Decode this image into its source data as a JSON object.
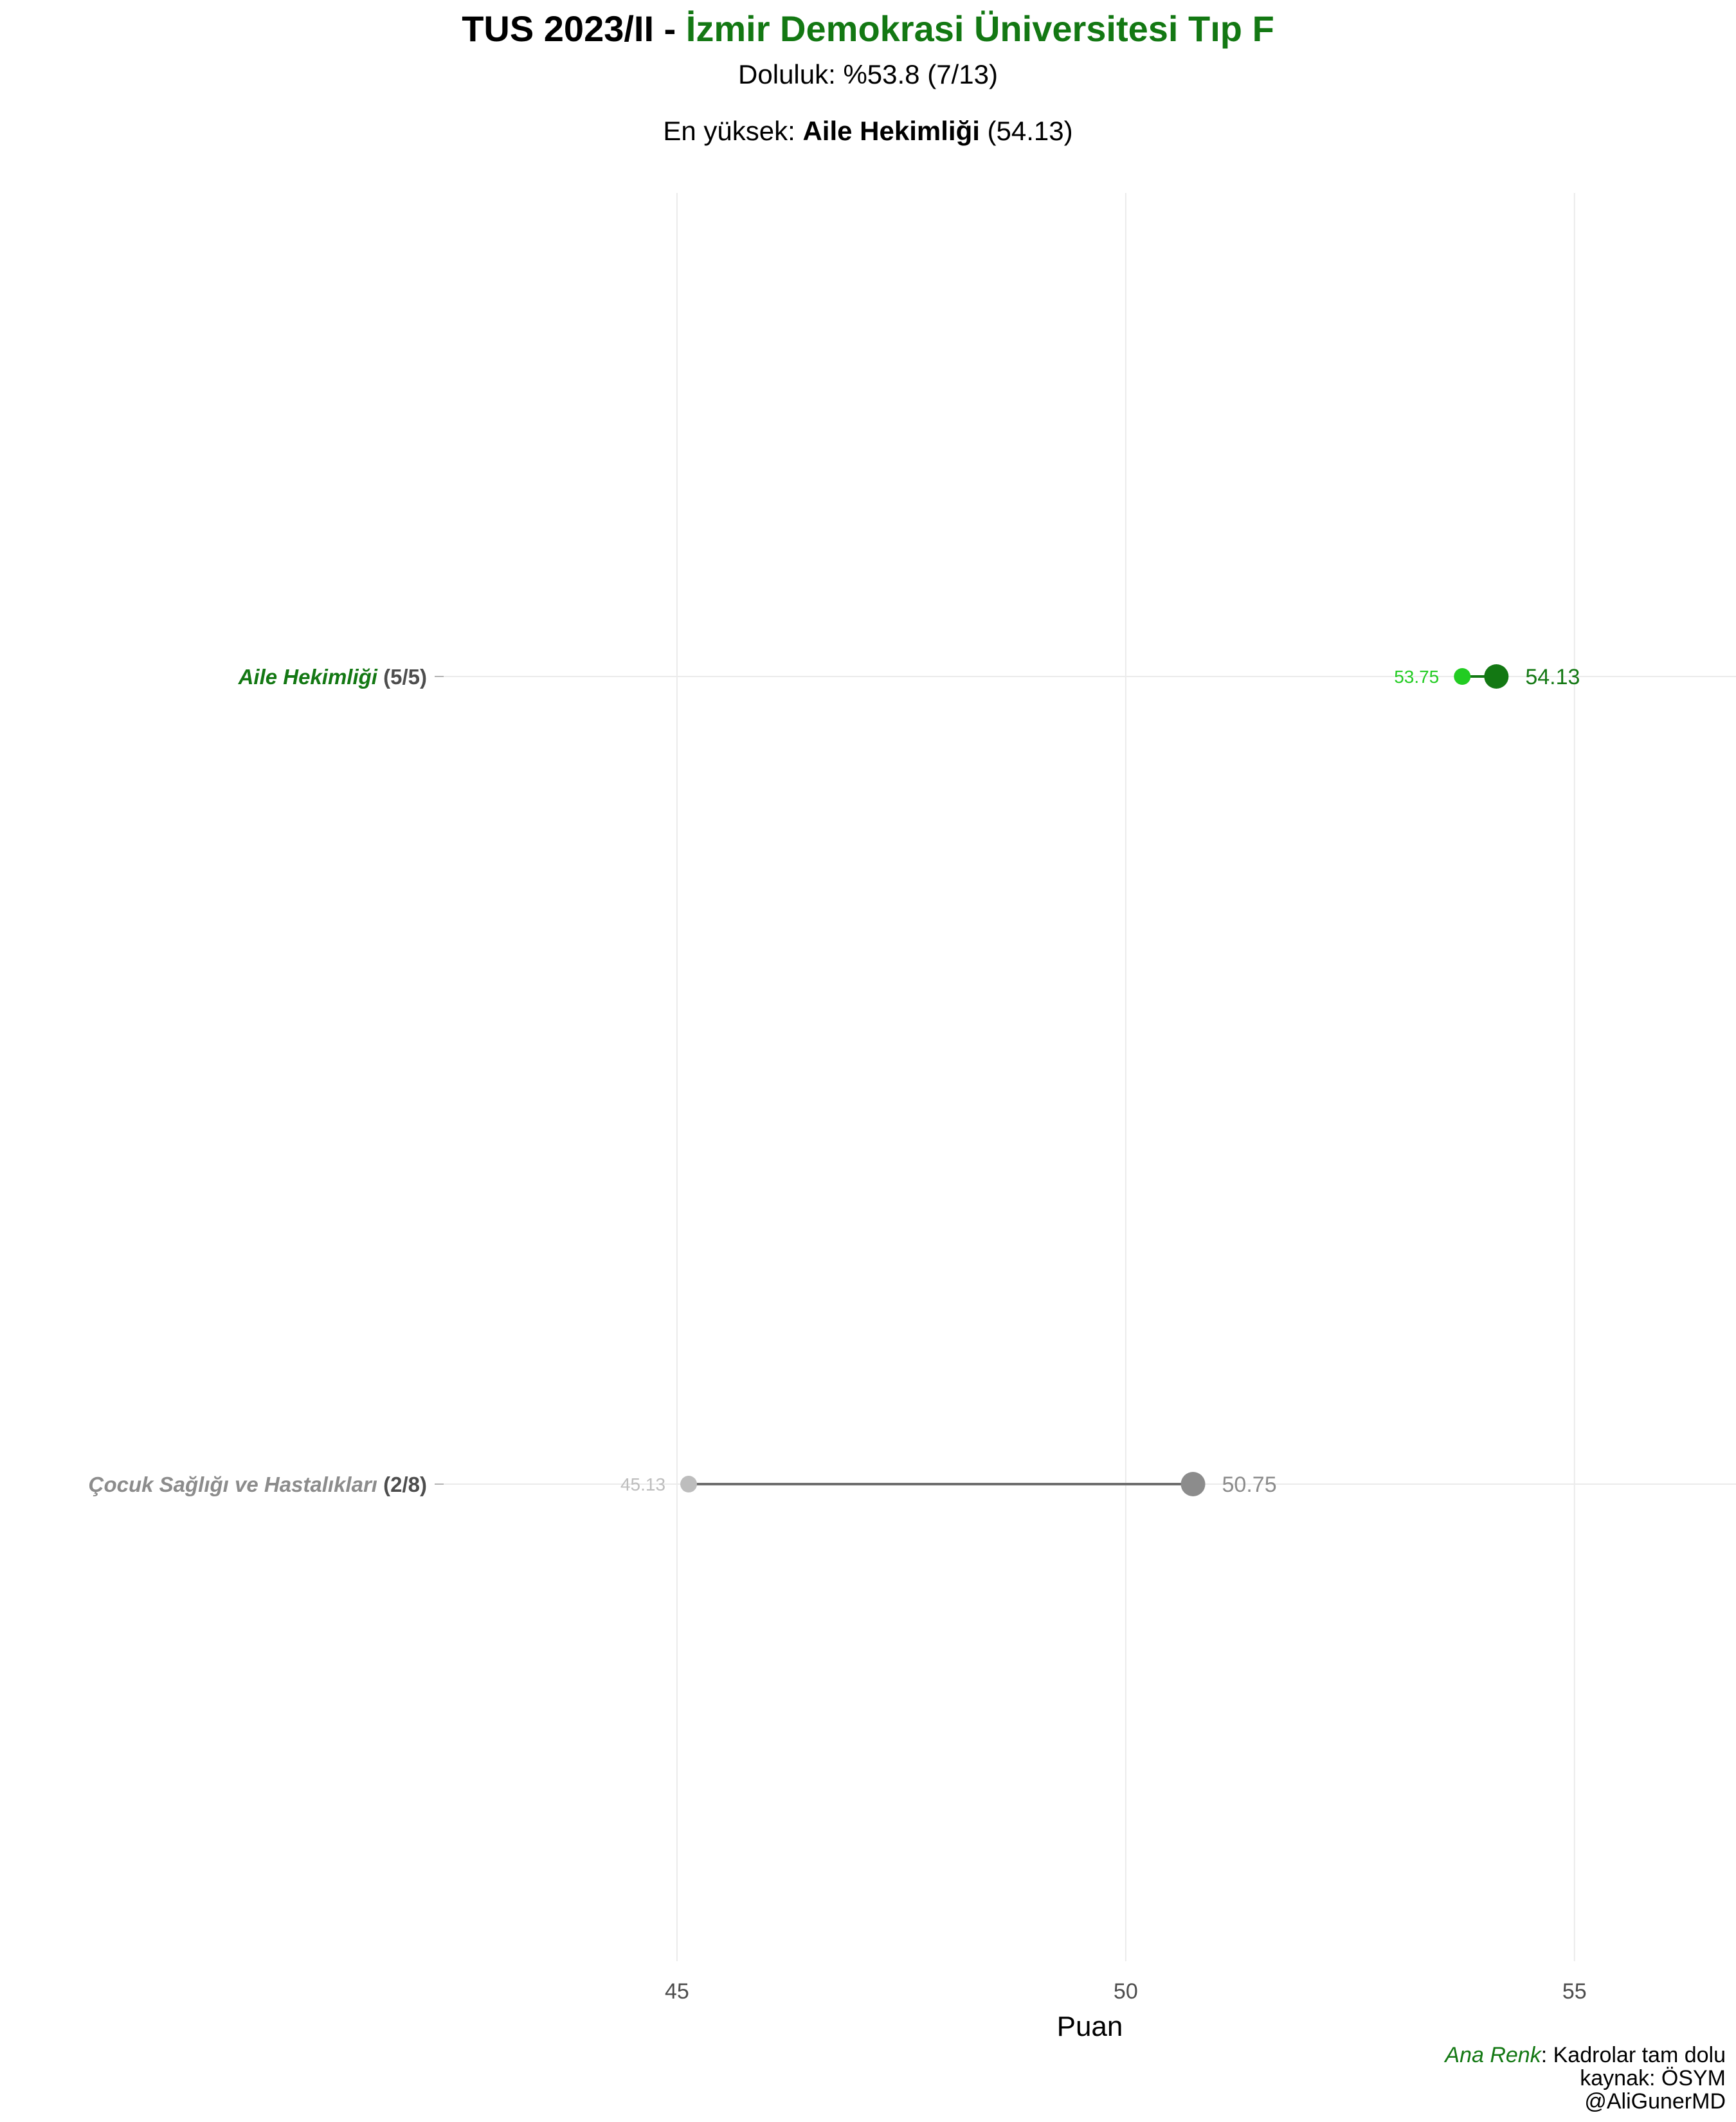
{
  "header": {
    "title_prefix": "TUS 2023/II - ",
    "title_highlight": "İzmir Demokrasi Üniversitesi Tıp F",
    "doluluk": "Doluluk: %53.8 (7/13)",
    "highest_prefix": "En yüksek: ",
    "highest_name": "Aile Hekimliği",
    "highest_value": " (54.13)"
  },
  "colors": {
    "accent": "#137813",
    "accent_light": "#22cc22",
    "gray_dark": "#8c8c8c",
    "gray_light": "#bdbdbd",
    "grid": "#ebebeb"
  },
  "chart_data": {
    "type": "dumbbell",
    "xlabel": "Puan",
    "xlim": [
      42.4,
      56.8
    ],
    "xticks": [
      45,
      50,
      55
    ],
    "grid": true,
    "rows": [
      {
        "name": "Aile Hekimliği",
        "count": "(5/5)",
        "min": 53.75,
        "max": 54.13,
        "min_label": "53.75",
        "max_label": "54.13",
        "full": true
      },
      {
        "name": "Çocuk Sağlığı ve Hastalıkları",
        "count": "(2/8)",
        "min": 45.13,
        "max": 50.75,
        "min_label": "45.13",
        "max_label": "50.75",
        "full": false
      }
    ]
  },
  "caption": {
    "legend_label": "Ana Renk",
    "legend_text": ": Kadrolar tam dolu",
    "source": "kaynak: ÖSYM",
    "author": "@AliGunerMD"
  }
}
